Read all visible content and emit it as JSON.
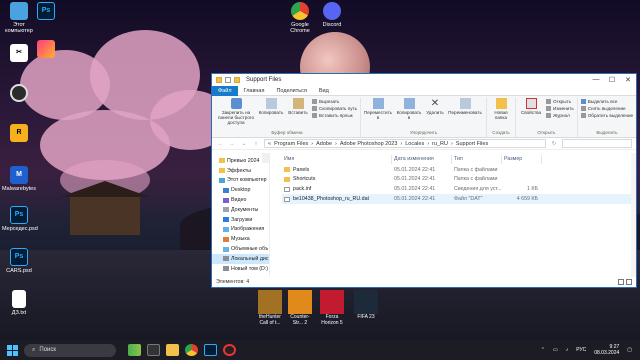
{
  "desktop": {
    "icons_left": [
      {
        "label": "Этот компьютер",
        "icon": "computer-icon",
        "color": "#4aa3e0"
      },
      {
        "label": "CapCut",
        "icon": "capcut-icon",
        "color": "#ffffff"
      },
      {
        "label": "OBS Studio",
        "icon": "obs-icon",
        "color": "#2b2b2b"
      },
      {
        "label": "Rockstar Games",
        "icon": "rockstar-icon",
        "color": "#f7b11d"
      },
      {
        "label": "Malwarebytes",
        "icon": "malwarebytes-icon",
        "color": "#1f5fce"
      },
      {
        "label": "Мерседес.psd",
        "icon": "psd-icon",
        "color": "#001d34",
        "abbr": "Ps"
      },
      {
        "label": "CARS.psd",
        "icon": "psd-icon",
        "color": "#001d34",
        "abbr": "Ps"
      },
      {
        "label": "ДЗ.txt",
        "icon": "txt-icon",
        "color": "#ffffff"
      }
    ],
    "icons_top": [
      {
        "label": "Photoshop",
        "icon": "photoshop-icon",
        "color": "#001d34",
        "abbr": "Ps"
      },
      {
        "label": "",
        "icon": "app-icon",
        "color": "#ff3d80"
      },
      {
        "label": "Google Chrome",
        "icon": "chrome-icon",
        "color": "#e3402f"
      },
      {
        "label": "Discord",
        "icon": "discord-icon",
        "color": "#5865f2"
      }
    ],
    "games": [
      {
        "label": "theHunter Call of t...",
        "color": "#a37124"
      },
      {
        "label": "Counter-Str... 2",
        "color": "#e08a1c"
      },
      {
        "label": "Forza Horizon 5",
        "color": "#c21a2f"
      },
      {
        "label": "FIFA 23",
        "color": "#1d2a3a"
      }
    ]
  },
  "explorer": {
    "title": "Support Files",
    "tabs": [
      "Файл",
      "Главная",
      "Поделиться",
      "Вид"
    ],
    "ribbon": {
      "pin": "Закрепить на панели быстрого доступа",
      "copy": "Копировать",
      "paste": "Вставить",
      "cut": "Вырезать",
      "copy_path": "Скопировать путь",
      "paste_shortcut": "Вставить ярлык",
      "clipboard": "Буфер обмена",
      "move_to": "Переместить в",
      "copy_to": "Копировать в",
      "delete": "Удалить",
      "rename": "Переименовать",
      "organize": "Упорядочить",
      "new_folder": "Новая папка",
      "create": "Создать",
      "properties": "Свойства",
      "open": "Открыть",
      "edit": "Изменить",
      "journal": "Журнал",
      "open_group": "Открыть",
      "select_all": "Выделить все",
      "select_none": "Снять выделение",
      "invert": "Обратить выделение",
      "select_group": "Выделить"
    },
    "path": [
      "Program Files",
      "Adobe",
      "Adobe Photoshop 2023",
      "Locales",
      "ru_RU",
      "Support Files"
    ],
    "nav": [
      {
        "label": "Превью 2024",
        "icon": "folder-icon"
      },
      {
        "label": "Эффекты",
        "icon": "folder-icon"
      },
      {
        "label": "Этот компьютер",
        "icon": "computer-icon"
      },
      {
        "label": "Desktop",
        "icon": "desktop-icon"
      },
      {
        "label": "Видео",
        "icon": "video-icon"
      },
      {
        "label": "Документы",
        "icon": "documents-icon"
      },
      {
        "label": "Загрузки",
        "icon": "downloads-icon"
      },
      {
        "label": "Изображения",
        "icon": "pictures-icon"
      },
      {
        "label": "Музыка",
        "icon": "music-icon"
      },
      {
        "label": "Объемные объ",
        "icon": "3d-icon"
      },
      {
        "label": "Локальный дис",
        "icon": "drive-icon"
      },
      {
        "label": "Новый том (D:)",
        "icon": "drive-icon"
      }
    ],
    "columns": [
      "Имя",
      "Дата изменения",
      "Тип",
      "Размер"
    ],
    "files": [
      {
        "name": "Panels",
        "date": "05.01.2024 22:41",
        "type": "Папка с файлами",
        "size": "",
        "icon": "folder-icon"
      },
      {
        "name": "Shortcuts",
        "date": "05.01.2024 22:41",
        "type": "Папка с файлами",
        "size": "",
        "icon": "folder-icon"
      },
      {
        "name": "pack.inf",
        "date": "05.01.2024 22:41",
        "type": "Сведения для уст...",
        "size": "1 КБ",
        "icon": "inf-icon"
      },
      {
        "name": "be10438_Photoshop_ru_RU.dat",
        "date": "05.01.2024 22:41",
        "type": "Файл \"DAT\"",
        "size": "4 659 КБ",
        "icon": "file-icon"
      }
    ],
    "status": "Элементов: 4"
  },
  "taskbar": {
    "search": "Поиск",
    "lang": "РУС",
    "time": "9:27",
    "date": "08.03.2024"
  }
}
